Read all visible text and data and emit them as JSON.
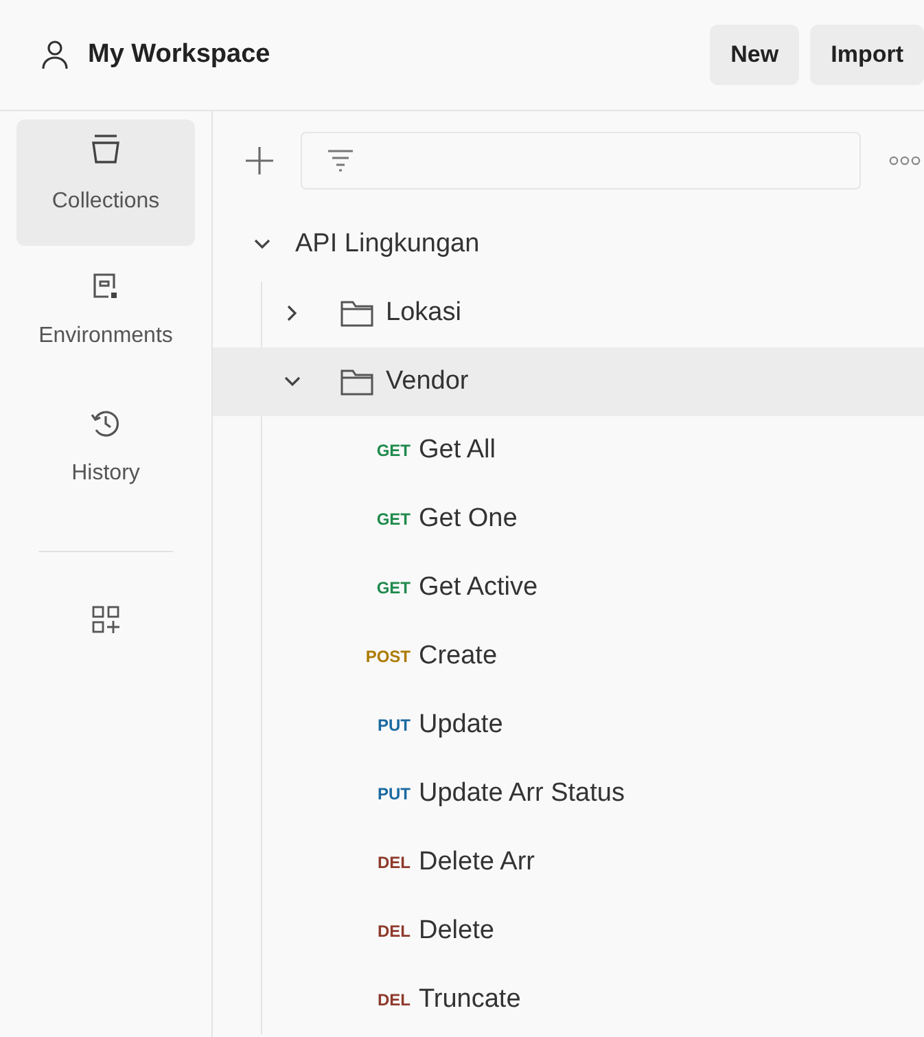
{
  "header": {
    "title": "My Workspace",
    "buttons": [
      "New",
      "Import"
    ]
  },
  "rail": [
    {
      "kind": "collections",
      "label": "Collections",
      "selected": true
    },
    {
      "kind": "environments",
      "label": "Environments",
      "selected": false
    },
    {
      "kind": "history",
      "label": "History",
      "selected": false
    },
    {
      "kind": "apps",
      "selected": false
    }
  ],
  "tree": [
    {
      "kind": "collection",
      "name": "API Lingkungan",
      "expanded": true,
      "selected": false,
      "children": [
        {
          "kind": "folder",
          "name": "Lokasi",
          "expanded": false,
          "selected": false
        },
        {
          "kind": "folder",
          "name": "Vendor",
          "expanded": true,
          "selected": true,
          "children": [
            {
              "kind": "get",
              "method": "GET",
              "name": "Get All",
              "selected": false
            },
            {
              "kind": "get",
              "method": "GET",
              "name": "Get One",
              "selected": false
            },
            {
              "kind": "get",
              "method": "GET",
              "name": "Get Active",
              "selected": false
            },
            {
              "kind": "post",
              "method": "POST",
              "name": "Create",
              "selected": false
            },
            {
              "kind": "put",
              "method": "PUT",
              "name": "Update",
              "selected": false
            },
            {
              "kind": "put",
              "method": "PUT",
              "name": "Update Arr Status",
              "selected": false
            },
            {
              "kind": "del",
              "method": "DEL",
              "name": "Delete Arr",
              "selected": false
            },
            {
              "kind": "del",
              "method": "DEL",
              "name": "Delete",
              "selected": false
            },
            {
              "kind": "del",
              "method": "DEL",
              "name": "Truncate",
              "selected": false
            }
          ]
        }
      ]
    }
  ]
}
